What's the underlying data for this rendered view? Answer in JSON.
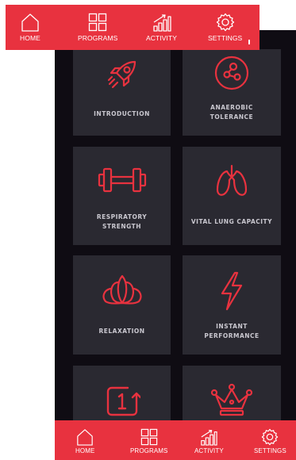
{
  "nav_top": {
    "items": [
      {
        "label": "HOME",
        "icon": "home-icon"
      },
      {
        "label": "PROGRAMS",
        "icon": "grid-icon"
      },
      {
        "label": "ACTIVITY",
        "icon": "bar-chart-icon"
      },
      {
        "label": "SETTINGS",
        "icon": "gear-icon"
      }
    ]
  },
  "nav_bottom": {
    "items": [
      {
        "label": "HOME",
        "icon": "home-icon"
      },
      {
        "label": "PROGRAMS",
        "icon": "grid-icon"
      },
      {
        "label": "ACTIVITY",
        "icon": "bar-chart-icon"
      },
      {
        "label": "SETTINGS",
        "icon": "gear-icon"
      }
    ]
  },
  "programs": [
    {
      "label": "INTRODUCTION",
      "icon": "rocket-icon"
    },
    {
      "label": "ANAEROBIC\nTOLERANCE",
      "icon": "cells-icon"
    },
    {
      "label": "RESPIRATORY\nSTRENGTH",
      "icon": "dumbbell-icon"
    },
    {
      "label": "VITAL LUNG CAPACITY",
      "icon": "lungs-icon"
    },
    {
      "label": "RELAXATION",
      "icon": "lotus-icon"
    },
    {
      "label": "INSTANT\nPERFORMANCE",
      "icon": "lightning-icon"
    },
    {
      "label": "",
      "icon": "repeat-one-icon"
    },
    {
      "label": "",
      "icon": "crown-icon"
    }
  ],
  "colors": {
    "accent": "#e8323f",
    "background": "#0f0c13",
    "tile": "#2a2931",
    "tile_text": "#c9c7cf"
  }
}
